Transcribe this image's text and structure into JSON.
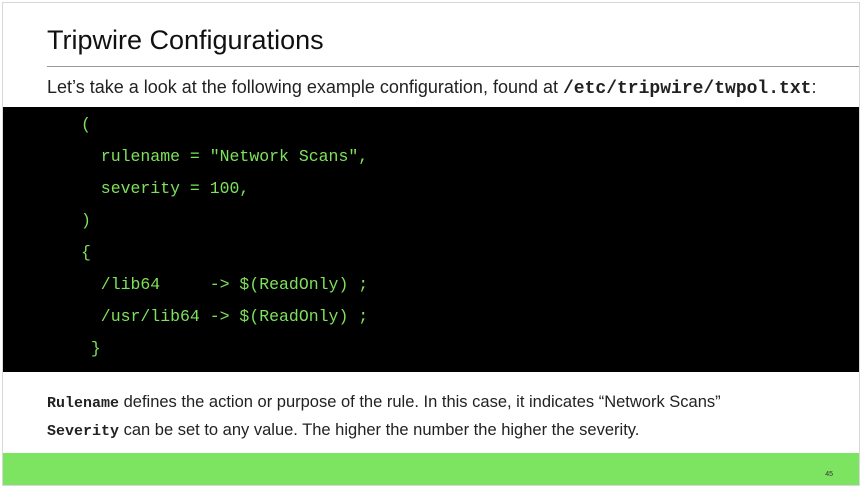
{
  "slide": {
    "title": "Tripwire Configurations",
    "intro_text": "Let’s take a look at the following example configuration, found at ",
    "intro_path": "/etc/tripwire/twpol.txt",
    "intro_suffix": ":",
    "code_lines": [
      "(",
      "  rulename = \"Network Scans\",",
      "  severity = 100,",
      ")",
      "{",
      "  /lib64     -> $(ReadOnly) ;",
      "  /usr/lib64 -> $(ReadOnly) ;",
      " }"
    ],
    "notes": [
      {
        "term": "Rulename",
        "text": " defines the action or purpose of the rule. In this case, it indicates “Network Scans”"
      },
      {
        "term": "Severity",
        "text": " can be set to any value. The higher the number the higher the severity."
      }
    ],
    "page_number": "45"
  },
  "colors": {
    "code_background": "#000000",
    "code_text": "#7ee15b",
    "footer_bar": "#7ce460"
  }
}
